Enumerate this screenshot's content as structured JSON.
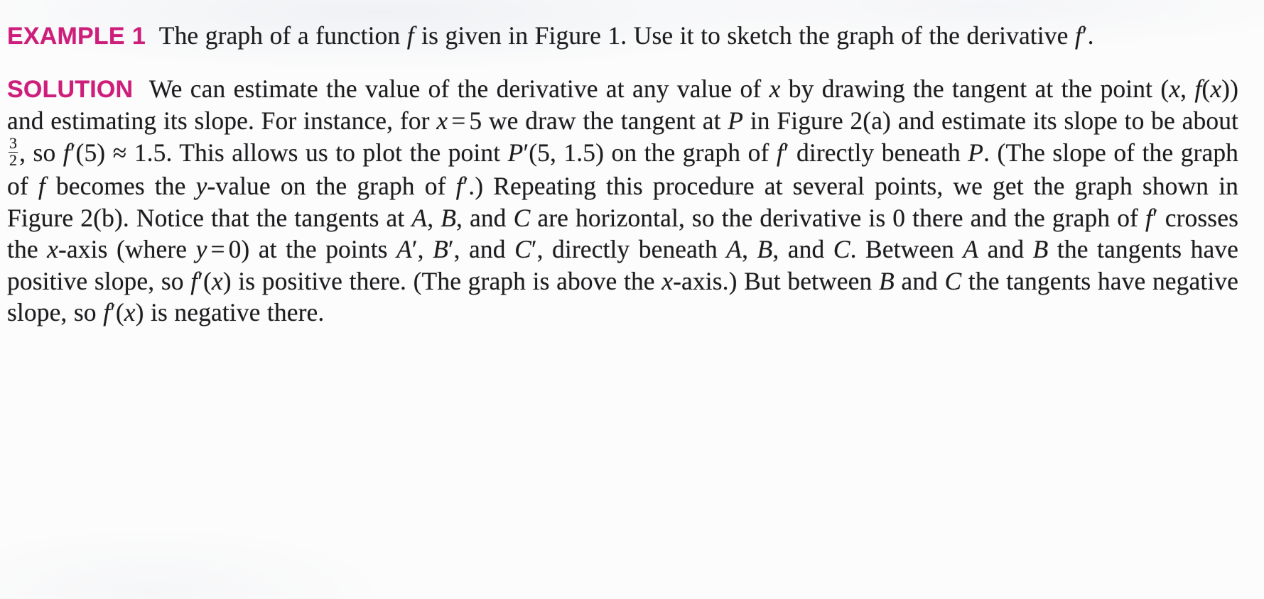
{
  "page": {
    "background_color": "#fcfcfc",
    "text_color": "#1d1d1f",
    "accent_color": "#cc1e7a"
  },
  "example": {
    "label": "EXAMPLE",
    "number": "1",
    "text_1": "The graph of a function ",
    "var_f": "f",
    "text_2": " is given in Figure 1. Use it to sketch the graph of the derivative ",
    "var_fprime": "f",
    "prime": "′",
    "text_3": "."
  },
  "solution": {
    "label": "SOLUTION",
    "seg_1": "We can estimate the value of the derivative at any value of ",
    "var_x_1": "x",
    "seg_2": " by drawing the tangent at the point (",
    "var_x_2": "x",
    "seg_3": ", ",
    "var_f_1": "f",
    "seg_4": "(",
    "var_x_3": "x",
    "seg_5": ")) and estimating its slope. For instance, for ",
    "var_x_4": "x",
    "eq": "=",
    "val_5": "5",
    "seg_6": " we draw the tangent at ",
    "var_P_1": "P",
    "seg_7": " in Figure 2(a) and estimate its slope to be about ",
    "frac_num": "3",
    "frac_den": "2",
    "seg_8": ", so ",
    "var_f_2": "f",
    "prime_1": "′",
    "seg_9": "(5) ",
    "approx": "≈",
    "seg_10": " 1.5. This allows us to plot the point ",
    "var_P_2": "P",
    "prime_2": "′",
    "seg_11": "(5, 1.5) on the graph of ",
    "var_f_3": "f",
    "prime_3": "′",
    "seg_12": " directly beneath ",
    "var_P_3": "P",
    "seg_13": ". (The slope of the graph of ",
    "var_f_4": "f",
    "seg_14": " becomes the ",
    "var_y_1": "y",
    "seg_15": "-value on the graph of ",
    "var_f_5": "f",
    "prime_4": "′",
    "seg_16": ".) Repeating this procedure at several points, we get the graph shown in Figure 2(b). Notice that the tangents at ",
    "var_A_1": "A",
    "seg_17": ", ",
    "var_B_1": "B",
    "seg_18": ", and ",
    "var_C_1": "C",
    "seg_19": " are horizontal, so the derivative is 0 there and the graph of ",
    "var_f_6": "f",
    "prime_5": "′",
    "seg_20": " crosses the ",
    "var_x_5": "x",
    "seg_21": "-axis (where ",
    "var_y_2": "y",
    "eq_2": "=",
    "val_0": "0",
    "seg_22": ") at the points ",
    "var_A_2": "A",
    "prime_6": "′",
    "seg_23": ", ",
    "var_B_2": "B",
    "prime_7": "′",
    "seg_24": ", and ",
    "var_C_2": "C",
    "prime_8": "′",
    "seg_25": ", directly beneath ",
    "var_A_3": "A",
    "seg_26": ", ",
    "var_B_3": "B",
    "seg_27": ", and ",
    "var_C_3": "C",
    "seg_28": ". Between ",
    "var_A_4": "A",
    "seg_29": " and ",
    "var_B_4": "B",
    "seg_30": " the tangents have positive slope, so ",
    "var_f_7": "f",
    "prime_9": "′",
    "seg_31": "(",
    "var_x_6": "x",
    "seg_32": ") is positive there. (The graph is above the ",
    "var_x_7": "x",
    "seg_33": "-axis.) But between ",
    "var_B_5": "B",
    "seg_34": " and ",
    "var_C_4": "C",
    "seg_35": " the tangents have negative slope, so ",
    "var_f_8": "f",
    "prime_10": "′",
    "seg_36": "(",
    "var_x_8": "x",
    "seg_37": ") is negative there."
  }
}
